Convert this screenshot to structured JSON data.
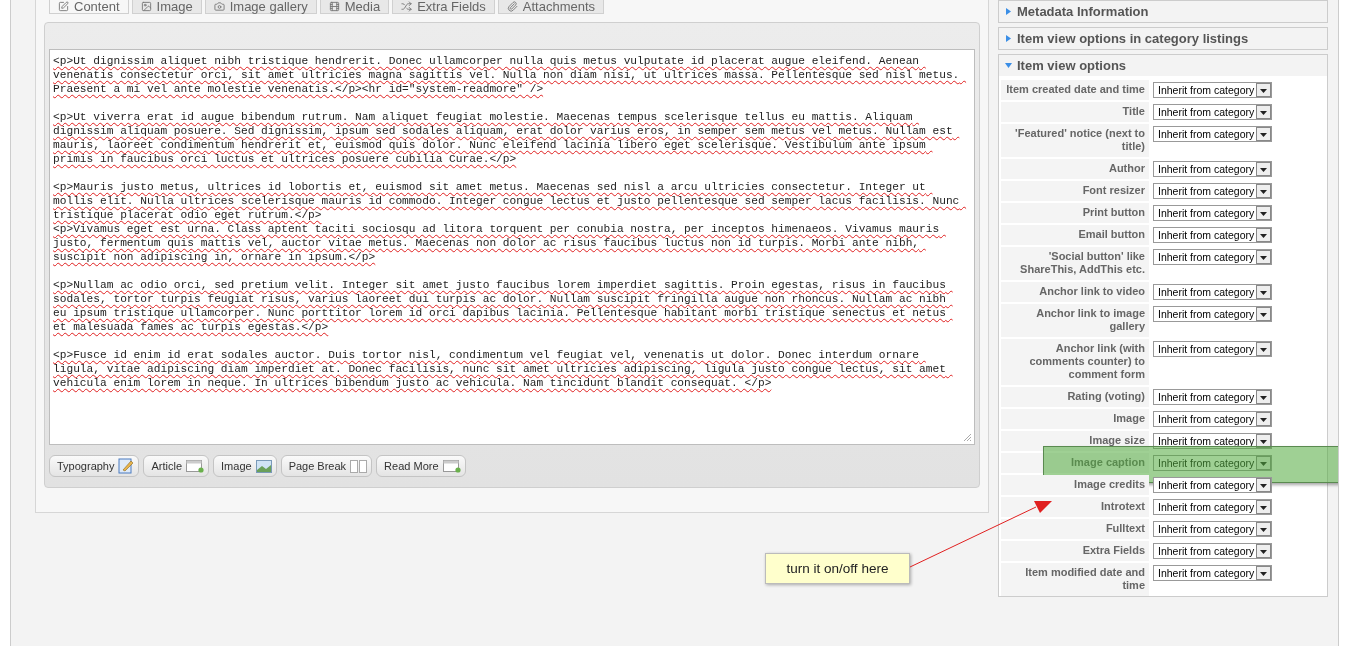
{
  "tabs": [
    {
      "label": "Content",
      "kind": "edit",
      "selected": true
    },
    {
      "label": "Image",
      "kind": "image",
      "selected": false
    },
    {
      "label": "Image gallery",
      "kind": "gallery",
      "selected": false
    },
    {
      "label": "Media",
      "kind": "media",
      "selected": false
    },
    {
      "label": "Extra Fields",
      "kind": "fields",
      "selected": false
    },
    {
      "label": "Attachments",
      "kind": "attachments",
      "selected": false
    }
  ],
  "editor": {
    "text": "<p>Ut dignissim aliquet nibh tristique hendrerit. Donec ullamcorper nulla quis metus vulputate id placerat augue eleifend. Aenean venenatis consectetur orci, sit amet ultricies magna sagittis vel. Nulla non diam nisi, ut ultrices massa. Pellentesque sed nisl metus. Praesent a mi vel ante molestie venenatis.</p><hr id=\"system-readmore\" />\n\n<p>Ut viverra erat id augue bibendum rutrum. Nam aliquet feugiat molestie. Maecenas tempus scelerisque tellus eu mattis. Aliquam dignissim aliquam posuere. Sed dignissim, ipsum sed sodales aliquam, erat dolor varius eros, in semper sem metus vel metus. Nullam est mauris, laoreet condimentum hendrerit et, euismod quis dolor. Nunc eleifend lacinia libero eget scelerisque. Vestibulum ante ipsum primis in faucibus orci luctus et ultrices posuere cubilia Curae.</p>\n\n<p>Mauris justo metus, ultrices id lobortis et, euismod sit amet metus. Maecenas sed nisl a arcu ultricies consectetur. Integer ut mollis elit. Nulla ultrices scelerisque mauris id commodo. Integer congue lectus et justo pellentesque sed semper lacus facilisis. Nunc tristique placerat odio eget rutrum.</p>\n<p>Vivamus eget est urna. Class aptent taciti sociosqu ad litora torquent per conubia nostra, per inceptos himenaeos. Vivamus mauris justo, fermentum quis mattis vel, auctor vitae metus. Maecenas non dolor ac risus faucibus luctus non id turpis. Morbi ante nibh, suscipit non adipiscing in, ornare in ipsum.</p>\n\n<p>Nullam ac odio orci, sed pretium velit. Integer sit amet justo faucibus lorem imperdiet sagittis. Proin egestas, risus in faucibus sodales, tortor turpis feugiat risus, varius laoreet dui turpis ac dolor. Nullam suscipit fringilla augue non rhoncus. Nullam ac nibh eu ipsum tristique ullamcorper. Nunc porttitor lorem id orci dapibus lacinia. Pellentesque habitant morbi tristique senectus et netus et malesuada fames ac turpis egestas.</p>\n\n<p>Fusce id enim id erat sodales auctor. Duis tortor nisl, condimentum vel feugiat vel, venenatis ut dolor. Donec interdum ornare ligula, vitae adipiscing diam imperdiet at. Donec facilisis, nunc sit amet ultricies adipiscing, ligula justo congue lectus, sit amet vehicula enim lorem in neque. In ultrices bibendum justo ac vehicula. Nam tincidunt blandit consequat. </p>"
  },
  "editor_buttons": [
    {
      "label": "Typography",
      "kind": "typography"
    },
    {
      "label": "Article",
      "kind": "article"
    },
    {
      "label": "Image",
      "kind": "image"
    },
    {
      "label": "Page Break",
      "kind": "pagebreak"
    },
    {
      "label": "Read More",
      "kind": "article"
    }
  ],
  "sidebar": {
    "sections": [
      {
        "title": "Metadata Information",
        "expanded": false
      },
      {
        "title": "Item view options in category listings",
        "expanded": false
      },
      {
        "title": "Item view options",
        "expanded": true,
        "options": [
          {
            "label": "Item created date and time",
            "value": "Inherit from category",
            "highlighted": false
          },
          {
            "label": "Title",
            "value": "Inherit from category",
            "highlighted": false
          },
          {
            "label": "'Featured' notice (next to title)",
            "value": "Inherit from category",
            "highlighted": false
          },
          {
            "label": "Author",
            "value": "Inherit from category",
            "highlighted": false
          },
          {
            "label": "Font resizer",
            "value": "Inherit from category",
            "highlighted": false
          },
          {
            "label": "Print button",
            "value": "Inherit from category",
            "highlighted": false
          },
          {
            "label": "Email button",
            "value": "Inherit from category",
            "highlighted": false
          },
          {
            "label": "'Social button' like ShareThis, AddThis etc.",
            "value": "Inherit from category",
            "highlighted": false
          },
          {
            "label": "Anchor link to video",
            "value": "Inherit from category",
            "highlighted": false
          },
          {
            "label": "Anchor link to image gallery",
            "value": "Inherit from category",
            "highlighted": false
          },
          {
            "label": "Anchor link (with comments counter) to comment form",
            "value": "Inherit from category",
            "highlighted": false
          },
          {
            "label": "Rating (voting)",
            "value": "Inherit from category",
            "highlighted": false
          },
          {
            "label": "Image",
            "value": "Inherit from category",
            "highlighted": false
          },
          {
            "label": "Image size",
            "value": "Inherit from category",
            "highlighted": false
          },
          {
            "label": "Image caption",
            "value": "Inherit from category",
            "highlighted": true
          },
          {
            "label": "Image credits",
            "value": "Inherit from category",
            "highlighted": false
          },
          {
            "label": "Introtext",
            "value": "Inherit from category",
            "highlighted": false
          },
          {
            "label": "Fulltext",
            "value": "Inherit from category",
            "highlighted": false
          },
          {
            "label": "Extra Fields",
            "value": "Inherit from category",
            "highlighted": false
          },
          {
            "label": "Item modified date and time",
            "value": "Inherit from category",
            "highlighted": false
          }
        ]
      }
    ]
  },
  "callout": {
    "text": "turn it on/off here"
  }
}
